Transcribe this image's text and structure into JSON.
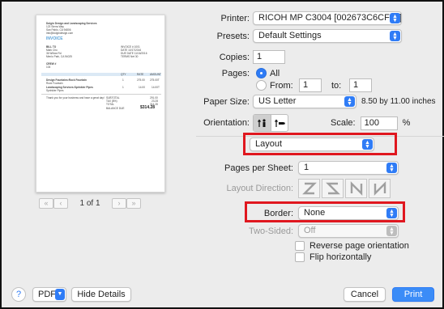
{
  "preview": {
    "company": "Dolgin Design and Landscaping Services",
    "address1": "123 Sierra Way",
    "address2": "San Pablo, CA 94806",
    "email": "info@dolgindesign.com",
    "invoice_title": "INVOICE",
    "bill_to_label": "BILL TO",
    "bill_to_1": "Mark Cho",
    "bill_to_2": "36 Willow Rd",
    "bill_to_3": "Menlo Park, CA 94025",
    "invoice_no": "INVOICE # 1001",
    "date": "DATE 10/17/2016",
    "due_date": "DUE DATE 11/16/2016",
    "terms": "TERMS Net 30",
    "crew_label": "CREW #",
    "crew_value": "104",
    "col_qty": "QTY",
    "col_rate": "RATE",
    "col_amount": "AMOUNT",
    "item1": "Design Fountains:Rock Fountain",
    "item1_sub": "Rock Fountain",
    "item1_qty": "1",
    "item1_rate": "275.00",
    "item1_amt": "275.00T",
    "item2": "Landscaping Services:Sprinkler Pipes",
    "item2_sub": "Sprinkler Pipes",
    "item2_qty": "1",
    "item2_rate": "14.00",
    "item2_amt": "14.00T",
    "thanks": "Thank you for your business and have a great day!",
    "subtotal_label": "SUBTOTAL",
    "subtotal": "291.00",
    "tax_label": "TAX (8%)",
    "tax": "23.28",
    "total_label": "TOTAL",
    "total": "314.28",
    "balance_label": "BALANCE DUE",
    "balance": "$314.28"
  },
  "pager": {
    "first": "«",
    "prev": "‹",
    "page_text": "1 of 1",
    "next": "›",
    "last": "»"
  },
  "printer": {
    "label": "Printer:",
    "value": "RICOH MP C3004 [002673C6CF58]"
  },
  "presets": {
    "label": "Presets:",
    "value": "Default Settings"
  },
  "copies": {
    "label": "Copies:",
    "value": "1"
  },
  "pages": {
    "label": "Pages:",
    "all_label": "All",
    "from_label": "From:",
    "from_value": "1",
    "to_label": "to:",
    "to_value": "1"
  },
  "paper_size": {
    "label": "Paper Size:",
    "value": "US Letter",
    "dims": "8.50 by 11.00 inches"
  },
  "orientation": {
    "label": "Orientation:"
  },
  "scale": {
    "label": "Scale:",
    "value": "100",
    "unit": "%"
  },
  "section": {
    "value": "Layout"
  },
  "pages_per_sheet": {
    "label": "Pages per Sheet:",
    "value": "1"
  },
  "layout_direction": {
    "label": "Layout Direction:"
  },
  "border": {
    "label": "Border:",
    "value": "None"
  },
  "two_sided": {
    "label": "Two-Sided:",
    "value": "Off"
  },
  "reverse_orientation": {
    "label": "Reverse page orientation"
  },
  "flip_horizontally": {
    "label": "Flip horizontally"
  },
  "bottom": {
    "help": "?",
    "pdf": "PDF",
    "hide_details": "Hide Details",
    "cancel": "Cancel",
    "print": "Print"
  },
  "colors": {
    "accent": "#2f7cf6",
    "highlight": "#e0171f"
  }
}
